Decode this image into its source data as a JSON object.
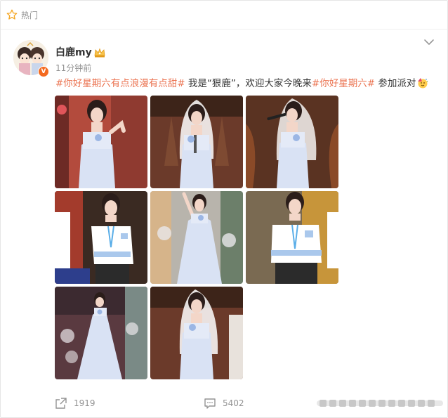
{
  "topbar": {
    "label": "热门"
  },
  "post": {
    "author": "白鹿my",
    "time": "11分钟前",
    "avatar_badge": "V",
    "tag1": "#你好星期六有点浪漫有点甜#",
    "text1": " 我是“狠鹿”，欢迎大家今晚来",
    "tag2": "#你好星期六#",
    "text2": " 参加派对",
    "emoji": "party-face"
  },
  "footer": {
    "repost_count": "1919",
    "comment_count": "5402"
  },
  "colors": {
    "accent": "#eb7350",
    "meta": "#939393",
    "badge": "#f46a1f"
  }
}
